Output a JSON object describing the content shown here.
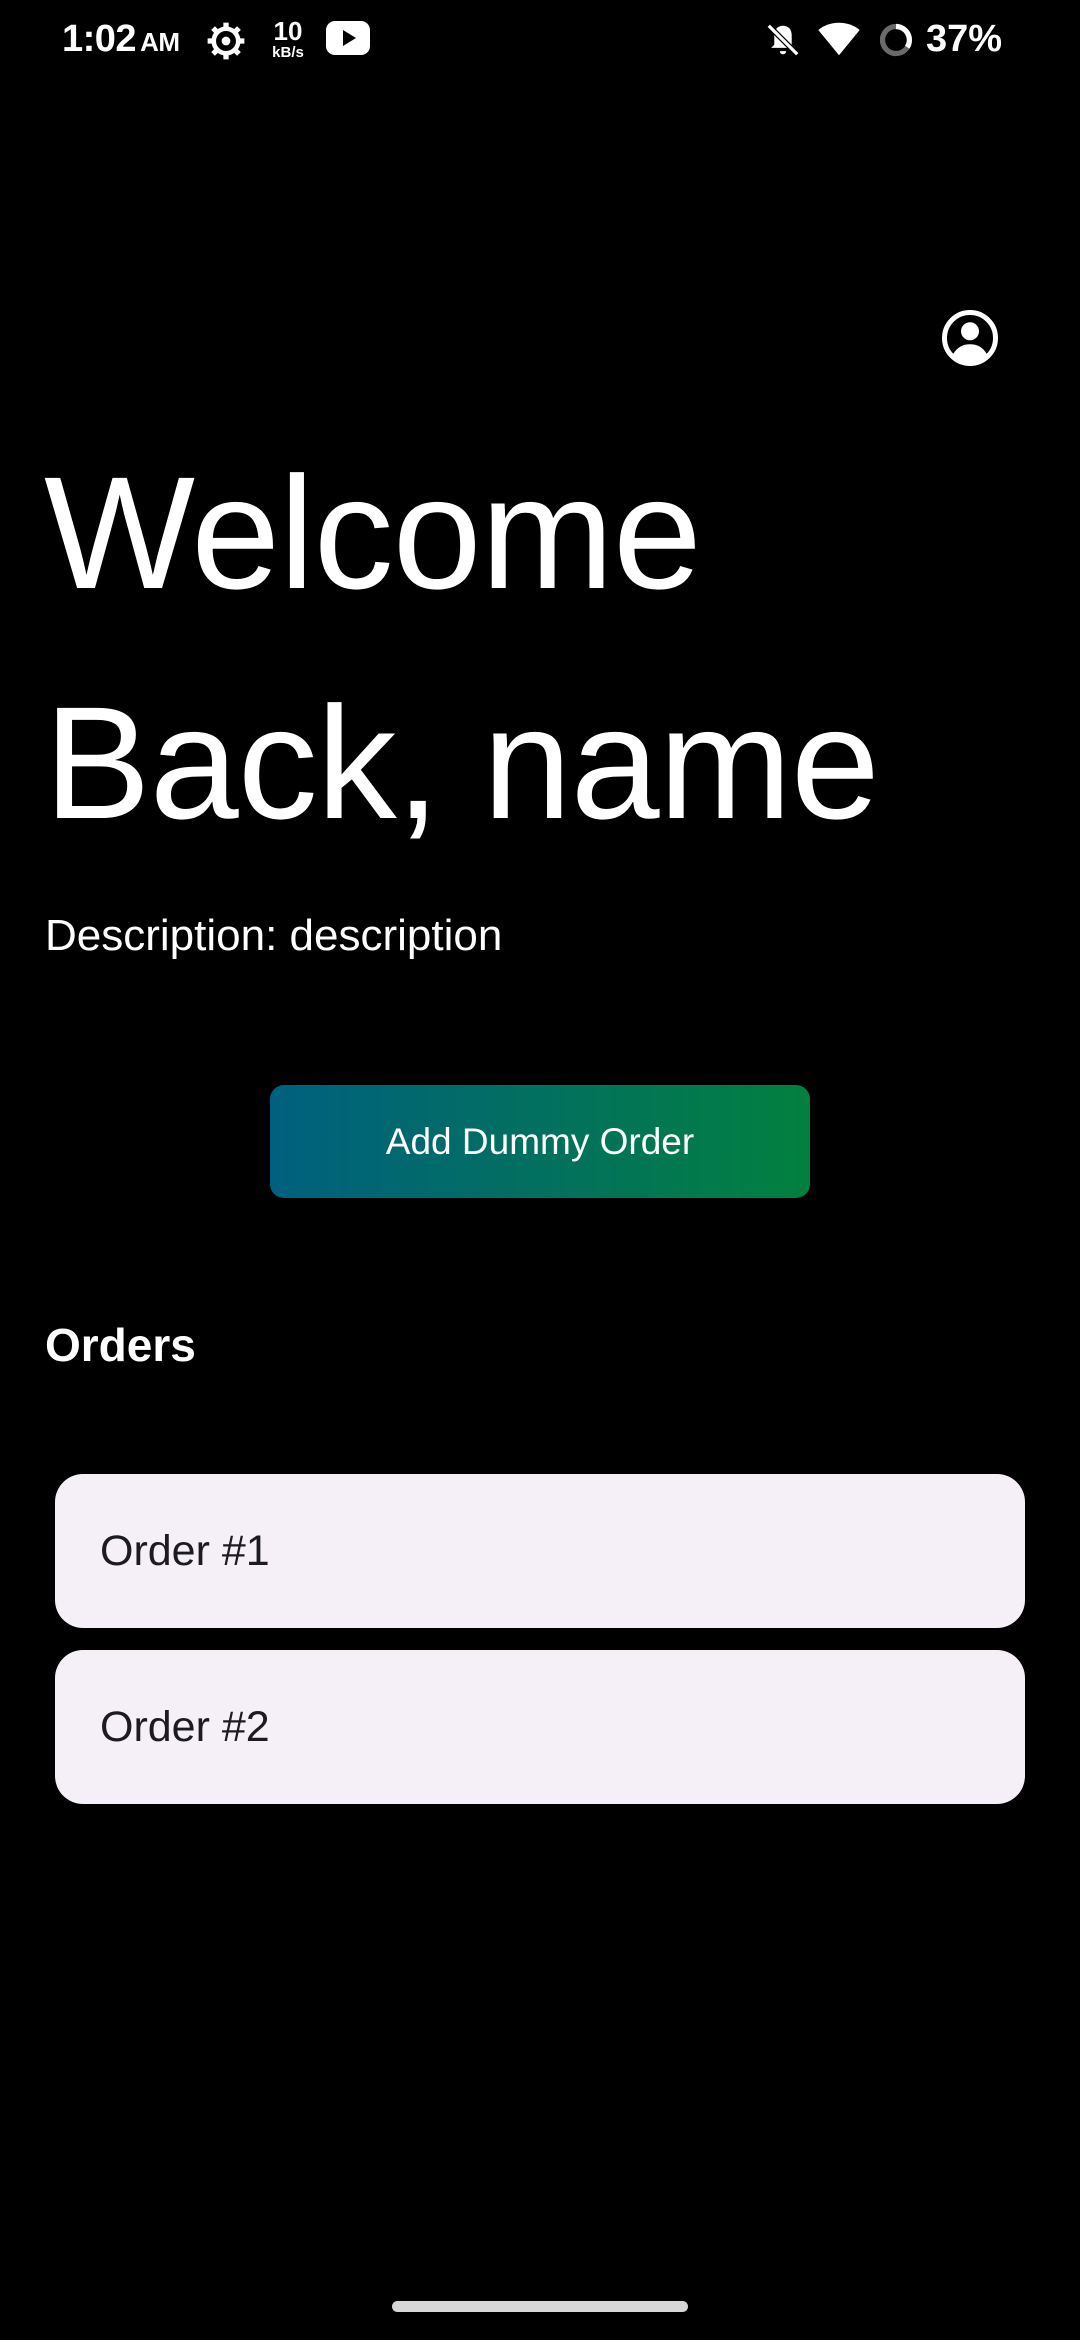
{
  "status_bar": {
    "time": "1:02",
    "ampm": "AM",
    "net_speed_value": "10",
    "net_speed_unit": "kB/s",
    "battery_percent": "37%",
    "icons": [
      "gear-icon",
      "youtube-icon",
      "bell-off-icon",
      "wifi-icon",
      "battery-icon"
    ]
  },
  "header": {
    "profile_icon": "account-circle-icon"
  },
  "main": {
    "title_line1": "Welcome",
    "title_line2": "Back, name",
    "description": "Description: description",
    "add_button_label": "Add Dummy Order",
    "orders_heading": "Orders",
    "orders": [
      {
        "label": "Order #1"
      },
      {
        "label": "Order #2"
      }
    ]
  },
  "colors": {
    "background": "#000000",
    "button_gradient_start": "#01607f",
    "button_gradient_end": "#02803f",
    "card_background": "#f5f0f8",
    "card_text": "#1c1b1f"
  }
}
